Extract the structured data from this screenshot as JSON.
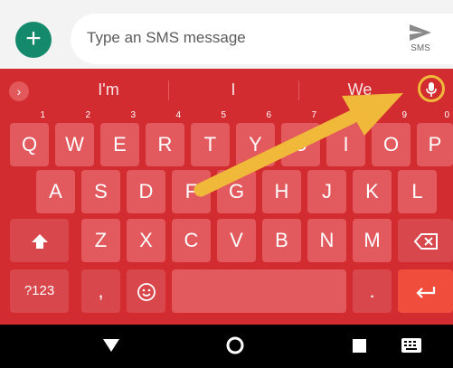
{
  "compose": {
    "add_icon": "plus-icon",
    "placeholder": "Type an SMS message",
    "send_label": "SMS",
    "send_icon": "send-arrow-icon"
  },
  "suggestions": {
    "expand_icon": "chevron-right-icon",
    "items": [
      "I'm",
      "I",
      "We"
    ],
    "mic_icon": "microphone-icon",
    "highlight_color": "#f1b93a"
  },
  "keyboard": {
    "background": "#d22c31",
    "row1": [
      {
        "label": "Q",
        "hint": "1"
      },
      {
        "label": "W",
        "hint": "2"
      },
      {
        "label": "E",
        "hint": "3"
      },
      {
        "label": "R",
        "hint": "4"
      },
      {
        "label": "T",
        "hint": "5"
      },
      {
        "label": "Y",
        "hint": "6"
      },
      {
        "label": "U",
        "hint": "7"
      },
      {
        "label": "I",
        "hint": "8"
      },
      {
        "label": "O",
        "hint": "9"
      },
      {
        "label": "P",
        "hint": "0"
      }
    ],
    "row2": [
      "A",
      "S",
      "D",
      "F",
      "G",
      "H",
      "J",
      "K",
      "L"
    ],
    "row3": [
      "Z",
      "X",
      "C",
      "V",
      "B",
      "N",
      "M"
    ],
    "shift_icon": "shift-arrow-icon",
    "backspace_icon": "backspace-icon",
    "symbols_label": "?123",
    "comma_label": ",",
    "emoji_icon": "emoji-icon",
    "period_label": ".",
    "enter_icon": "enter-icon"
  },
  "navbar": {
    "back_icon": "back-triangle-icon",
    "home_icon": "home-circle-icon",
    "recents_icon": "recents-square-icon",
    "keyboard_icon": "keyboard-switch-icon"
  },
  "annotation": {
    "arrow_color": "#f1b93a"
  }
}
